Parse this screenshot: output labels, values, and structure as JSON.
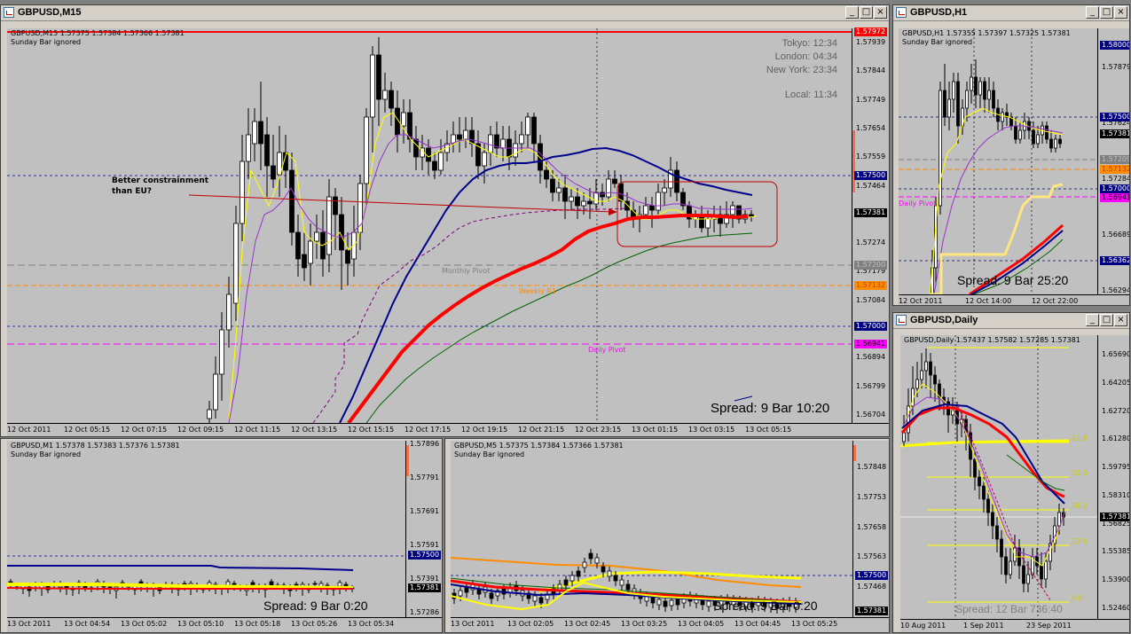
{
  "colors": {
    "background": "#c0c0c0",
    "bull_candle": "#ffffff",
    "bear_candle": "#000000",
    "resistance_line": "#ff0000",
    "ma_yellow": "#ffff00",
    "ma_purple": "#9933cc",
    "ma_blue": "#00008b",
    "ma_red": "#ff0000",
    "ma_green": "#006400",
    "daily_pivot": "#ff00ff",
    "weekly_r1": "#ff8c00",
    "highlight_box": "#c00000"
  },
  "m15": {
    "title": "GBPUSD,M15",
    "header_line1": "GBPUSD,M15  1.57375  1.57384  1.57366  1.57381",
    "header_line2": "Sunday Bar ignored",
    "prices": [
      "1.57939",
      "1.57844",
      "1.57749",
      "1.57654",
      "1.57559",
      "1.57464",
      "1.57369",
      "1.57274",
      "1.57179",
      "1.57084",
      "1.56989",
      "1.56894",
      "1.56799",
      "1.56704"
    ],
    "price_tags": {
      "top": "1.57972",
      "current": "1.57381",
      "level_1": "1.57500",
      "monthly": "1.57200",
      "weekly": "1.57132",
      "level_2": "1.57000",
      "pivot": "1.56941"
    },
    "clock": {
      "tokyo": "Tokyo: 12:34",
      "london": "London: 04:34",
      "new_york": "New York: 23:34",
      "local": "Local: 11:34"
    },
    "annotation_line1": "Better constrainment",
    "annotation_line2": "than EU?",
    "labels": {
      "monthly_pivot": "Monthly Pivot",
      "weekly_r1": "Weekly R1",
      "daily_pivot": "Daily Pivot"
    },
    "spread": "Spread: 9 Bar  10:20",
    "times": [
      "12 Oct 2011",
      "12 Oct 05:15",
      "12 Oct 07:15",
      "12 Oct 09:15",
      "12 Oct 11:15",
      "12 Oct 13:15",
      "12 Oct 15:15",
      "12 Oct 17:15",
      "12 Oct 19:15",
      "12 Oct 21:15",
      "12 Oct 23:15",
      "13 Oct 01:15",
      "13 Oct 03:15",
      "13 Oct 05:15"
    ]
  },
  "h1": {
    "title": "GBPUSD,H1",
    "header_line1": "GBPUSD,H1  1.57355  1.57397  1.57325  1.57381",
    "header_line2": "Sunday Bar ignored",
    "prices": [
      "1.57879",
      "1.57624",
      "1.57284",
      "1.56689",
      "1.56294"
    ],
    "price_tags": {
      "top": "1.58000",
      "upper": "1.57500",
      "current": "1.57381",
      "mid": "1.57209",
      "orange": "1.57132",
      "level": "1.57000",
      "pivot": "1.56941",
      "low": "1.56362"
    },
    "pivot_label": "Daily Pivot",
    "spread": "Spread: 9 Bar  25:20",
    "times": [
      "12 Oct 2011",
      "12 Oct 14:00",
      "12 Oct 22:00"
    ]
  },
  "daily": {
    "title": "GBPUSD,Daily",
    "header_line1": "GBPUSD,Daily  1.57437  1.57582  1.57285  1.57381",
    "prices": [
      "1.65690",
      "1.64205",
      "1.62720",
      "1.61280",
      "1.59795",
      "1.58310",
      "1.56825",
      "1.55385",
      "1.53900",
      "1.52460"
    ],
    "current_tag": "1.57381",
    "fib_levels": [
      "61.8",
      "50.0",
      "38.2",
      "23.6",
      "0.0"
    ],
    "spread": "Spread: 12 Bar  736:40",
    "times": [
      "10 Aug 2011",
      "1 Sep 2011",
      "23 Sep 2011"
    ]
  },
  "m1": {
    "header_line1": "GBPUSD,M1  1.57378  1.57383  1.57376  1.57381",
    "header_line2": "Sunday Bar ignored",
    "prices": [
      "1.57896",
      "1.57791",
      "1.57691",
      "1.57591",
      "1.57391",
      "1.57286"
    ],
    "price_tags": {
      "level": "1.57500",
      "current": "1.57381"
    },
    "spread": "Spread: 9   Bar  0:20",
    "times": [
      "13 Oct 2011",
      "13 Oct 04:54",
      "13 Oct 05:02",
      "13 Oct 05:10",
      "13 Oct 05:18",
      "13 Oct 05:26",
      "13 Oct 05:34"
    ]
  },
  "m5": {
    "header_line1": "GBPUSD,M5  1.57375  1.57384  1.57366  1.57381",
    "header_line2": "Sunday Bar ignored",
    "prices": [
      "1.57848",
      "1.57753",
      "1.57658",
      "1.57563",
      "1.57468"
    ],
    "price_tags": {
      "level": "1.57500",
      "current": "1.57381"
    },
    "spread": "Spread: 9   Bar  0:20",
    "times": [
      "13 Oct 2011",
      "13 Oct 02:05",
      "13 Oct 02:45",
      "13 Oct 03:25",
      "13 Oct 04:05",
      "13 Oct 04:45",
      "13 Oct 05:25"
    ]
  }
}
